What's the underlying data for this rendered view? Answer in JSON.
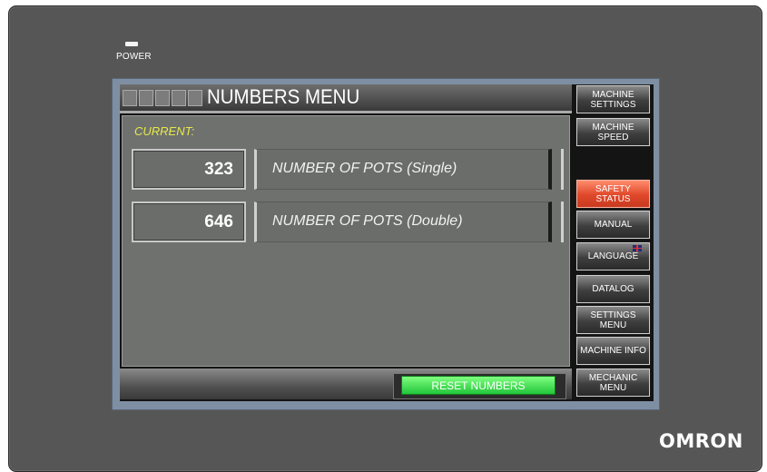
{
  "device": {
    "power_label": "POWER",
    "brand": "OMRON"
  },
  "header": {
    "title": "NUMBERS MENU"
  },
  "main": {
    "current_label": "CURRENT:",
    "rows": [
      {
        "value": "323",
        "label": "NUMBER OF POTS (Single)"
      },
      {
        "value": "646",
        "label": "NUMBER OF POTS (Double)"
      }
    ]
  },
  "footer": {
    "reset_label": "RESET NUMBERS",
    "reset_color": "#3ee35a"
  },
  "sidebar": {
    "items": [
      {
        "label": "MACHINE SETTINGS"
      },
      {
        "label": "MACHINE SPEED"
      },
      {
        "label": "SAFETY STATUS",
        "color": "#e9553a"
      },
      {
        "label": "MANUAL"
      },
      {
        "label": "LANGUAGE",
        "icon": "uk-flag-icon"
      },
      {
        "label": "DATALOG"
      },
      {
        "label": "SETTINGS MENU"
      },
      {
        "label": "MACHINE INFO"
      },
      {
        "label": "MECHANIC MENU"
      }
    ]
  }
}
